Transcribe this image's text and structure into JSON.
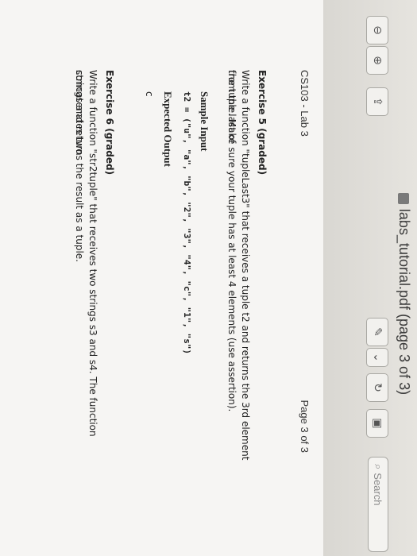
{
  "window": {
    "title": "labs_tutorial.pdf (page 3 of 3)",
    "search_placeholder": "Search"
  },
  "page": {
    "course_header": "CS103 - Lab 3",
    "page_number": "Page 3 of 3"
  },
  "exercise5": {
    "title": "Exercise 5 (graded)",
    "line1": "Write a function \"tupleLast3\" that receives a tuple t2 and returns the 3rd element from the last of",
    "line2": "the tuple. Make sure your tuple has at least 4 elements (use assertion).",
    "sample_input_label": "Sample Input",
    "sample_input_code": "t2 = (\"u\", \"a\", \"b\", \"2\", \"3\", \"4\", \"c\", \"1\", \"s\")",
    "expected_output_label": "Expected Output",
    "expected_output_value": "c"
  },
  "exercise6": {
    "title": "Exercise 6 (graded)",
    "line1": "Write a function \"str2tuple\" that receives two strings s3 and s4. The function concatenates two",
    "line2": "strings and returns the result as a tuple."
  },
  "icons": [
    "zoom-out-icon",
    "zoom-in-icon",
    "share-icon",
    "pen-icon",
    "chevron-down-icon",
    "rotate-icon",
    "toolbox-icon",
    "search-icon"
  ]
}
